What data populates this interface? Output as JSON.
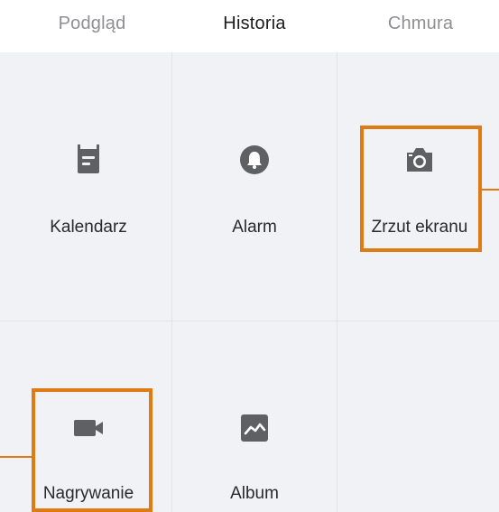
{
  "tabs": [
    {
      "label": "Podgląd",
      "active": false
    },
    {
      "label": "Historia",
      "active": true
    },
    {
      "label": "Chmura",
      "active": false
    }
  ],
  "grid": {
    "items": [
      {
        "label": "Kalendarz",
        "icon": "calendar-icon"
      },
      {
        "label": "Alarm",
        "icon": "bell-icon"
      },
      {
        "label": "Zrzut ekranu",
        "icon": "camera-icon"
      },
      {
        "label": "Nagrywanie",
        "icon": "video-camera-icon"
      },
      {
        "label": "Album",
        "icon": "image-icon"
      }
    ]
  },
  "colors": {
    "icon": "#5f6064",
    "highlight": "#e07a12",
    "grid_background": "#f1f2f5",
    "active_tab": "#1c1c1e",
    "inactive_tab": "#8e8e93"
  }
}
